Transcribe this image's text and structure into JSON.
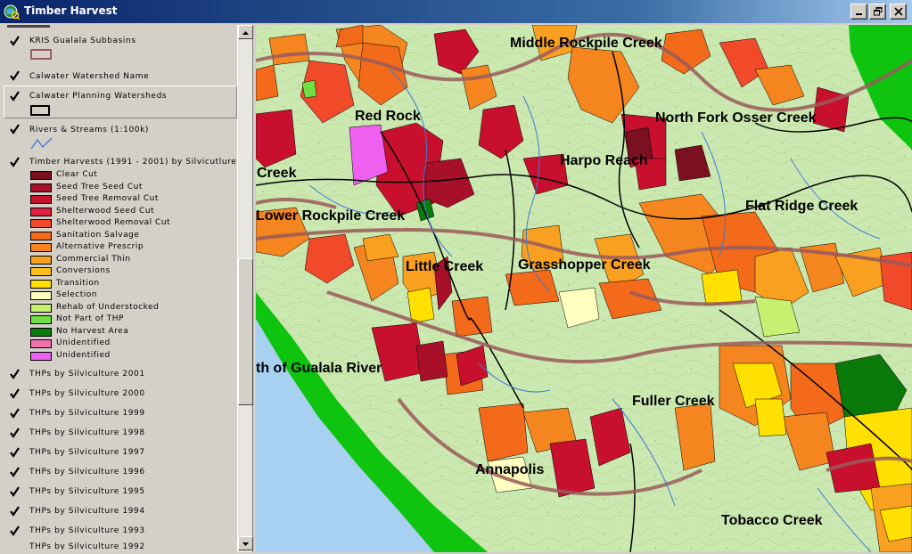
{
  "window": {
    "title": "Timber Harvest"
  },
  "legend": {
    "layers": {
      "kris": "KRIS Gualala Subbasins",
      "calwater_name": "Calwater Watershed Name",
      "calwater_planning": "Calwater Planning Watersheds",
      "rivers": "Rivers & Streams (1:100k)",
      "timber": "Timber Harvests (1991 - 2001) by Silvicutlure"
    },
    "classes": [
      {
        "label": "Clear Cut",
        "color": "#7a1020"
      },
      {
        "label": "Seed Tree Seed Cut",
        "color": "#a8102a"
      },
      {
        "label": "Seed Tree Removal Cut",
        "color": "#c8102e"
      },
      {
        "label": "Shelterwood Seed Cut",
        "color": "#e02040"
      },
      {
        "label": "Shelterwood Removal Cut",
        "color": "#f04a2a"
      },
      {
        "label": "Sanitation Salvage",
        "color": "#f26a1a"
      },
      {
        "label": "Alternative Prescrip",
        "color": "#f5851f"
      },
      {
        "label": "Commercial Thin",
        "color": "#f9a020"
      },
      {
        "label": "Conversions",
        "color": "#fbbf1a"
      },
      {
        "label": "Transition",
        "color": "#ffe000"
      },
      {
        "label": "Selection",
        "color": "#ffffc0"
      },
      {
        "label": "Rehab of Understocked",
        "color": "#c8f070"
      },
      {
        "label": "Not Part of THP",
        "color": "#70e040"
      },
      {
        "label": "No Harvest Area",
        "color": "#0a7a0a"
      },
      {
        "label": "Unidentified",
        "color": "#f070b0"
      },
      {
        "label": "Unidentified",
        "color": "#f060f0"
      }
    ],
    "thp_layers": [
      "THPs by Silviculture 2001",
      "THPs by Silviculture 2000",
      "THPs by Silviculture 1999",
      "THPs by Silviculture 1998",
      "THPs by Silviculture 1997",
      "THPs by Silviculture 1996",
      "THPs by Silviculture 1995",
      "THPs by Silviculture 1994",
      "THPs by Silviculture 1993"
    ],
    "thp_partial": "THPs by Silviculture 1992"
  },
  "map": {
    "labels": {
      "middle_rockpile": "Middle Rockpile Creek",
      "red_rock": "Red Rock",
      "north_fork_osser": "North Fork Osser Creek",
      "harpo_reach": "Harpo Reach",
      "creek": "Creek",
      "flat_ridge": "Flat Ridge Creek",
      "lower_rockpile": "Lower Rockpile Creek",
      "little_creek": "Little Creek",
      "grasshopper": "Grasshopper Creek",
      "mouth_gualala": "th of Gualala River",
      "fuller": "Fuller Creek",
      "annapolis": "Annapolis",
      "tobacco": "Tobacco Creek"
    }
  },
  "colors": {
    "titlebar": "#0a246a",
    "ocean": "#a8d0f0",
    "land": "#cbe8b0",
    "forest_green": "#0fc40f",
    "subbasin_line": "#9a5a5a",
    "stream": "#3a7ad8"
  }
}
